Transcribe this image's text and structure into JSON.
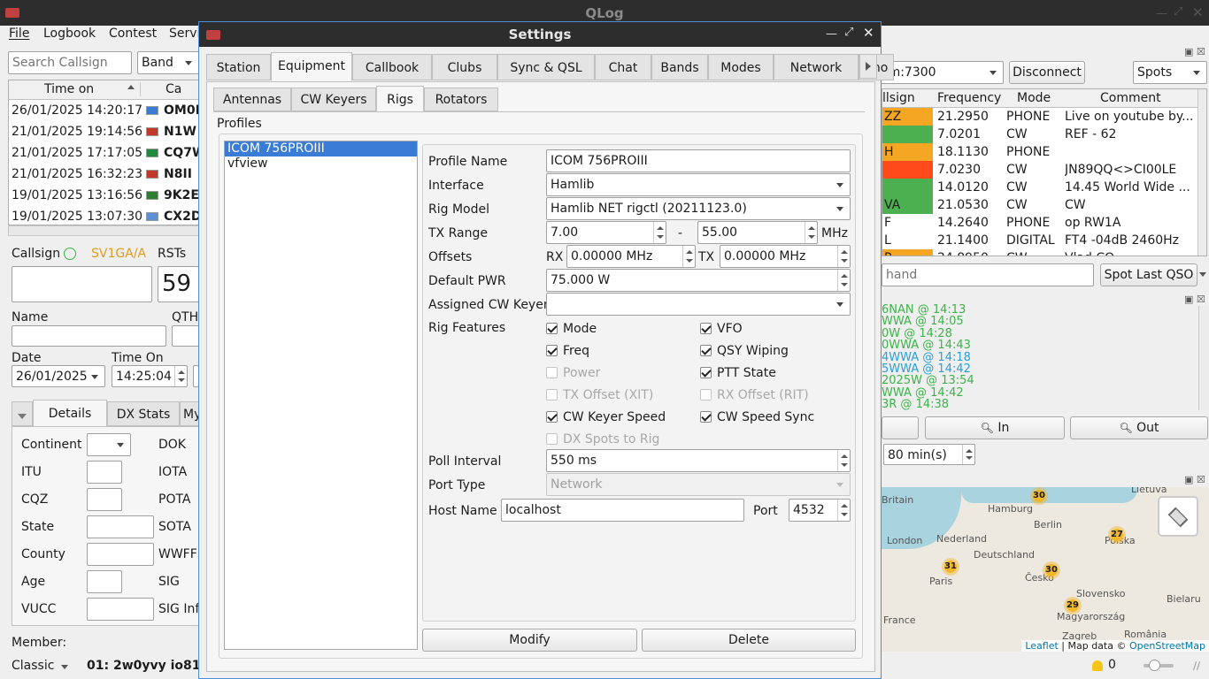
{
  "app": {
    "title": "QLog"
  },
  "menu": [
    "File",
    "Logbook",
    "Contest",
    "Servi"
  ],
  "search": {
    "placeholder": "Search Callsign",
    "band_value": "Band"
  },
  "log_table": {
    "headers": [
      "Time on",
      "Ca"
    ],
    "rows": [
      {
        "time": "26/01/2025 14:20:17",
        "call": "OM0E"
      },
      {
        "time": "21/01/2025 19:14:56",
        "call": "N1W"
      },
      {
        "time": "21/01/2025 17:17:05",
        "call": "CQ7W"
      },
      {
        "time": "21/01/2025 16:32:23",
        "call": "N8II"
      },
      {
        "time": "19/01/2025 13:16:56",
        "call": "9K2ES"
      },
      {
        "time": "19/01/2025 13:07:30",
        "call": "CX2D"
      }
    ]
  },
  "qso_entry": {
    "callsign_label": "Callsign",
    "my_callsign": "SV1GA/A",
    "rsts_label": "RSTs",
    "rst_value": "59",
    "name_label": "Name",
    "qth_label": "QTH",
    "date_label": "Date",
    "date_value": "26/01/2025",
    "time_on_label": "Time On",
    "time_on_value": "14:25:04"
  },
  "detail_tabs": [
    "Details",
    "DX Stats",
    "My"
  ],
  "details": {
    "left": [
      "Continent",
      "ITU",
      "CQZ",
      "State",
      "County",
      "Age",
      "VUCC"
    ],
    "right": [
      "DOK",
      "IOTA",
      "POTA",
      "SOTA",
      "WWFF",
      "SIG",
      "SIG Inf"
    ],
    "member_label": "Member:",
    "member_value": "Classic",
    "member_info": "01:  2w0yvy  io81ar"
  },
  "dialog": {
    "title": "Settings",
    "tabs": [
      "Station",
      "Equipment",
      "Callbook",
      "Clubs",
      "Sync & QSL",
      "Chat",
      "Bands",
      "Modes",
      "Network",
      "Sho"
    ],
    "subtabs": [
      "Antennas",
      "CW Keyers",
      "Rigs",
      "Rotators"
    ],
    "profiles_label": "Profiles",
    "profiles": [
      "ICOM 756PROIII",
      "vfview"
    ],
    "form": {
      "profile_name_label": "Profile Name",
      "profile_name": "ICOM 756PROIII",
      "interface_label": "Interface",
      "interface": "Hamlib",
      "rig_model_label": "Rig Model",
      "rig_model": "Hamlib NET rigctl (20211123.0)",
      "tx_range_label": "TX Range",
      "tx_from": "7.00",
      "tx_dash": "-",
      "tx_to": "55.00",
      "tx_unit": "MHz",
      "offsets_label": "Offsets",
      "rx_label": "RX",
      "rx_offset": "0.00000 MHz",
      "tx_label": "TX",
      "tx_offset": "0.00000 MHz",
      "default_pwr_label": "Default PWR",
      "default_pwr": "75.000 W",
      "cw_keyer_label": "Assigned CW Keyer",
      "cw_keyer": "",
      "rig_features_label": "Rig Features",
      "features": [
        {
          "label": "Mode",
          "checked": true,
          "disabled": false
        },
        {
          "label": "VFO",
          "checked": true,
          "disabled": false
        },
        {
          "label": "Freq",
          "checked": true,
          "disabled": false
        },
        {
          "label": "QSY Wiping",
          "checked": true,
          "disabled": false
        },
        {
          "label": "Power",
          "checked": false,
          "disabled": true
        },
        {
          "label": "PTT State",
          "checked": true,
          "disabled": false
        },
        {
          "label": "TX Offset (XIT)",
          "checked": false,
          "disabled": true
        },
        {
          "label": "RX Offset (RIT)",
          "checked": false,
          "disabled": true
        },
        {
          "label": "CW Keyer Speed",
          "checked": true,
          "disabled": false
        },
        {
          "label": "CW Speed Sync",
          "checked": true,
          "disabled": false
        },
        {
          "label": "DX Spots to Rig",
          "checked": false,
          "disabled": true
        }
      ],
      "poll_interval_label": "Poll Interval",
      "poll_interval": "550 ms",
      "port_type_label": "Port Type",
      "port_type": "Network",
      "host_name_label": "Host Name",
      "host_name": "localhost",
      "port_label": "Port",
      "port": "4532"
    },
    "modify_label": "Modify",
    "delete_label": "Delete"
  },
  "rig_connect": {
    "port": "om:7300",
    "disconnect_label": "Disconnect",
    "spots_label": "Spots"
  },
  "spots_table": {
    "headers": [
      "llsign",
      "Frequency",
      "Mode",
      "Comment"
    ],
    "rows": [
      {
        "call": "ZZ",
        "freq": "21.2950",
        "mode": "PHONE",
        "comment": "Live on youtube by...",
        "color": "#f5a623"
      },
      {
        "call": "",
        "freq": "7.0201",
        "mode": "CW",
        "comment": "REF - 62",
        "color": "#4caf50"
      },
      {
        "call": "H",
        "freq": "18.1130",
        "mode": "PHONE",
        "comment": "",
        "color": "#f5a623"
      },
      {
        "call": "",
        "freq": "7.0230",
        "mode": "CW",
        "comment": "JN89QQ<>CI00LE",
        "color": "#ff4a1c"
      },
      {
        "call": "",
        "freq": "14.0120",
        "mode": "CW",
        "comment": "14.45 World Wide ...",
        "color": "#4caf50"
      },
      {
        "call": "VA",
        "freq": "21.0530",
        "mode": "CW",
        "comment": "CW",
        "color": "#4caf50"
      },
      {
        "call": "F",
        "freq": "14.2640",
        "mode": "PHONE",
        "comment": "op RW1A",
        "color": "#ffffff"
      },
      {
        "call": "L",
        "freq": "21.1400",
        "mode": "DIGITAL",
        "comment": "FT4 -04dB 2460Hz",
        "color": "#ffffff"
      },
      {
        "call": "P",
        "freq": "24.8950",
        "mode": "CW",
        "comment": "Vlad CQ",
        "color": "#f5a623"
      }
    ]
  },
  "command": {
    "placeholder": "hand",
    "spot_last_label": "Spot Last QSO"
  },
  "chat_lines": [
    {
      "text": "6NAN @ 14:13",
      "color": "#3cb34a"
    },
    {
      "text": "WWA @ 14:05",
      "color": "#3cb34a"
    },
    {
      "text": "0W @ 14:28",
      "color": "#3cb34a"
    },
    {
      "text": "0WWA @ 14:43",
      "color": "#3cb34a"
    },
    {
      "text": "4WWA @ 14:18",
      "color": "#2a9fd8"
    },
    {
      "text": "5WWA @ 14:42",
      "color": "#2a9fd8"
    },
    {
      "text": "2025W @ 13:54",
      "color": "#3cb34a"
    },
    {
      "text": "WWA @ 14:42",
      "color": "#3cb34a"
    },
    {
      "text": "3R @ 14:38",
      "color": "#3cb34a"
    }
  ],
  "zoom": {
    "in_label": "In",
    "out_label": "Out",
    "interval": "80 min(s)"
  },
  "map": {
    "labels": [
      {
        "t": "Lietuva"
      },
      {
        "t": "Britain"
      },
      {
        "t": "Hamburg"
      },
      {
        "t": "Berlin"
      },
      {
        "t": "Nederland"
      },
      {
        "t": "Polska"
      },
      {
        "t": "London"
      },
      {
        "t": "Deutschland"
      },
      {
        "t": "Paris"
      },
      {
        "t": "Česko"
      },
      {
        "t": "Slovensko"
      },
      {
        "t": "France"
      },
      {
        "t": "Magyarország"
      },
      {
        "t": "Zagreb"
      },
      {
        "t": "România"
      },
      {
        "t": "Bielaru"
      }
    ],
    "clusters": [
      "30",
      "27",
      "31",
      "30",
      "29"
    ],
    "attribution_leaflet": "Leaflet",
    "attribution_sep": " | Map data © ",
    "attribution_osm": "OpenStreetMap"
  },
  "status": {
    "alerts": "0"
  }
}
